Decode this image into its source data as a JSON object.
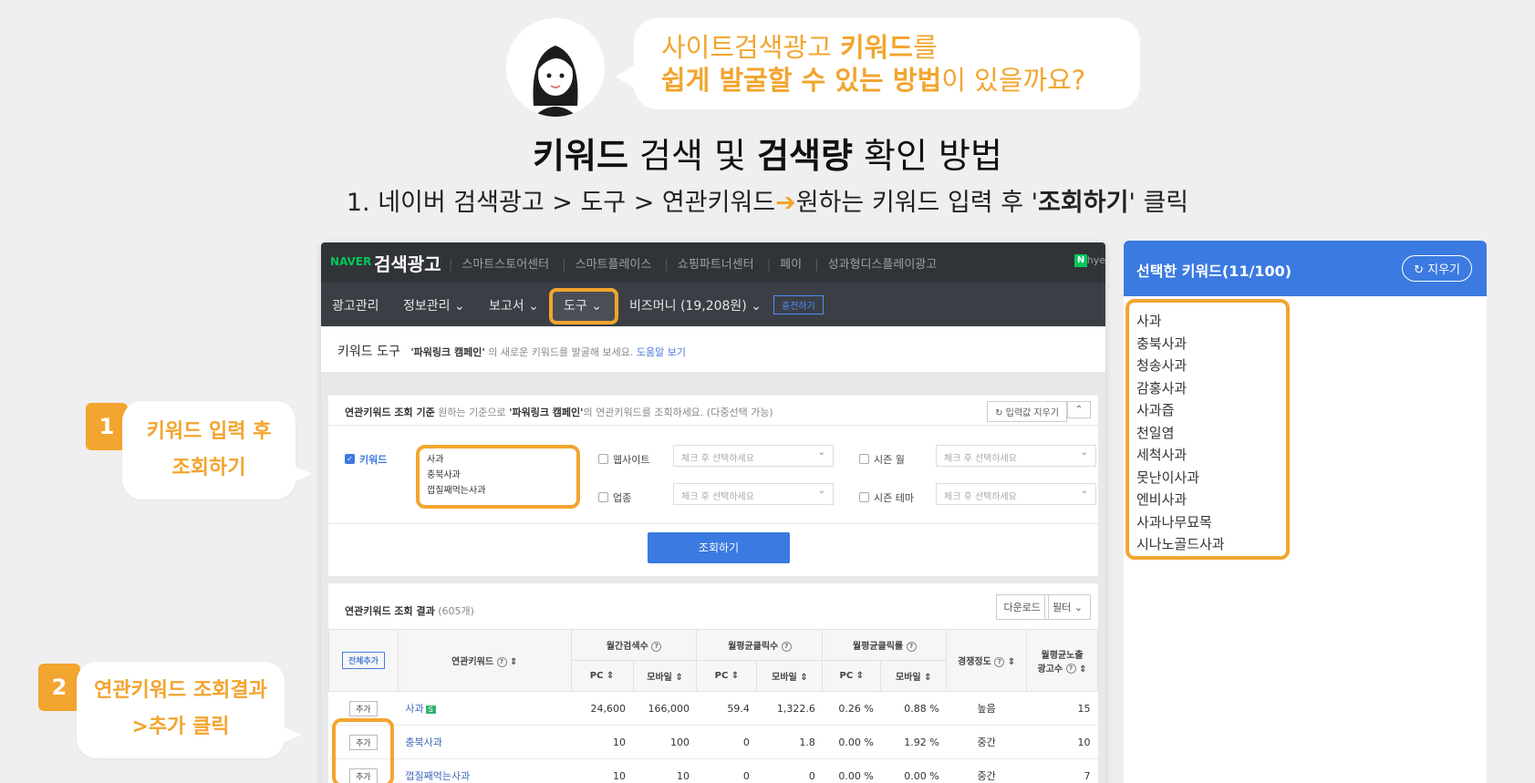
{
  "header": {
    "bubble_line1_pre": "사이트검색광고 ",
    "bubble_line1_bold": "키워드",
    "bubble_line1_post": "를",
    "bubble_line2_bold": "쉽게 발굴할 수 있는 방법",
    "bubble_line2_post": "이 있을까요?",
    "title_bold1": "키워드",
    "title_mid": " 검색 및 ",
    "title_bold2": "검색량",
    "title_post": " 확인 방법",
    "subtitle_pre": "1. 네이버 검색광고 > 도구 > 연관키워드",
    "subtitle_arrow": "➔",
    "subtitle_mid": "원하는 키워드 입력 후 '",
    "subtitle_bold": "조회하기",
    "subtitle_post": "' 클릭"
  },
  "naver": {
    "logo_naver": "NAVER",
    "logo_ad": "검색광고",
    "top_links": [
      "스마트스토어센터",
      "스마트플레이스",
      "쇼핑파트너센터",
      "페이",
      "성과형디스플레이광고"
    ],
    "n_icon": "N",
    "user": "hye",
    "nav": {
      "ad_manage": "광고관리",
      "info_manage": "정보관리 ⌄",
      "report": "보고서 ⌄",
      "tool": "도구 ⌄",
      "bizmoney": "비즈머니 (19,208원) ⌄",
      "charge": "충전하기"
    },
    "tool_title": "키워드 도구",
    "tool_desc_bold": "'파워링크 캠페인'",
    "tool_desc": " 의 새로운 키워드를 발굴해 보세요.",
    "tool_help": "도움말 보기",
    "query_head_bold": "연관키워드 조회 기준",
    "query_head_desc_pre": "  원하는 기준으로 ",
    "query_head_desc_bold": "'파워링크 캠페인'",
    "query_head_desc_post": "의 연관키워드를 조회하세요. (다중선택 가능)",
    "clear_input": "↻ 입력값 지우기",
    "collapse": "⌃",
    "keyword_label": "키워드",
    "keywords_entered": [
      "사과",
      "충북사과",
      "껍질째먹는사과"
    ],
    "website_label": "웹사이트",
    "season_month_label": "시즌 월",
    "industry_label": "업종",
    "season_theme_label": "시즌 테마",
    "select_placeholder": "체크 후 선택하세요",
    "search_button": "조회하기",
    "results_head_bold": "연관키워드 조회 결과",
    "results_count": " (605개)",
    "download": "다운로드",
    "filter": "필터 ⌄",
    "table": {
      "all_add": "전체추가",
      "col_keyword": "연관키워드",
      "col_monthly_search": "월간검색수",
      "col_avg_clicks": "월평균클릭수",
      "col_avg_ctr": "월평균클릭률",
      "col_competition": "경쟁정도",
      "col_avg_ads_line1": "월평균노출",
      "col_avg_ads_line2": "광고수",
      "sub_pc": "PC",
      "sub_mobile": "모바일",
      "add_label": "추가",
      "rows": [
        {
          "keyword": "사과",
          "badge": "S",
          "pc_search": "24,600",
          "mo_search": "166,000",
          "pc_click": "59.4",
          "mo_click": "1,322.6",
          "pc_ctr": "0.26 %",
          "mo_ctr": "0.88 %",
          "competition": "높음",
          "ads": "15"
        },
        {
          "keyword": "충북사과",
          "badge": "",
          "pc_search": "10",
          "mo_search": "100",
          "pc_click": "0",
          "mo_click": "1.8",
          "pc_ctr": "0.00 %",
          "mo_ctr": "1.92 %",
          "competition": "중간",
          "ads": "10"
        },
        {
          "keyword": "껍질째먹는사과",
          "badge": "",
          "pc_search": "10",
          "mo_search": "10",
          "pc_click": "0",
          "mo_click": "0",
          "pc_ctr": "0.00 %",
          "mo_ctr": "0.00 %",
          "competition": "중간",
          "ads": "7"
        }
      ]
    }
  },
  "selected": {
    "title": "선택한 키워드(11/100)",
    "erase": "↻ 지우기",
    "items": [
      "사과",
      "충북사과",
      "청송사과",
      "감홍사과",
      "사과즙",
      "천일염",
      "세척사과",
      "못난이사과",
      "엔비사과",
      "사과나무묘목",
      "시나노골드사과"
    ]
  },
  "callouts": {
    "step1_num": "1",
    "step1_line1": "키워드 입력 후",
    "step1_line2": "조회하기",
    "step2_num": "2",
    "step2_line1": "연관키워드 조회결과",
    "step2_line2": ">추가 클릭"
  },
  "colors": {
    "accent": "#f2a52f",
    "naver_blue": "#3b7ae0",
    "naver_green": "#03c75a",
    "dark_bar": "#303338"
  }
}
